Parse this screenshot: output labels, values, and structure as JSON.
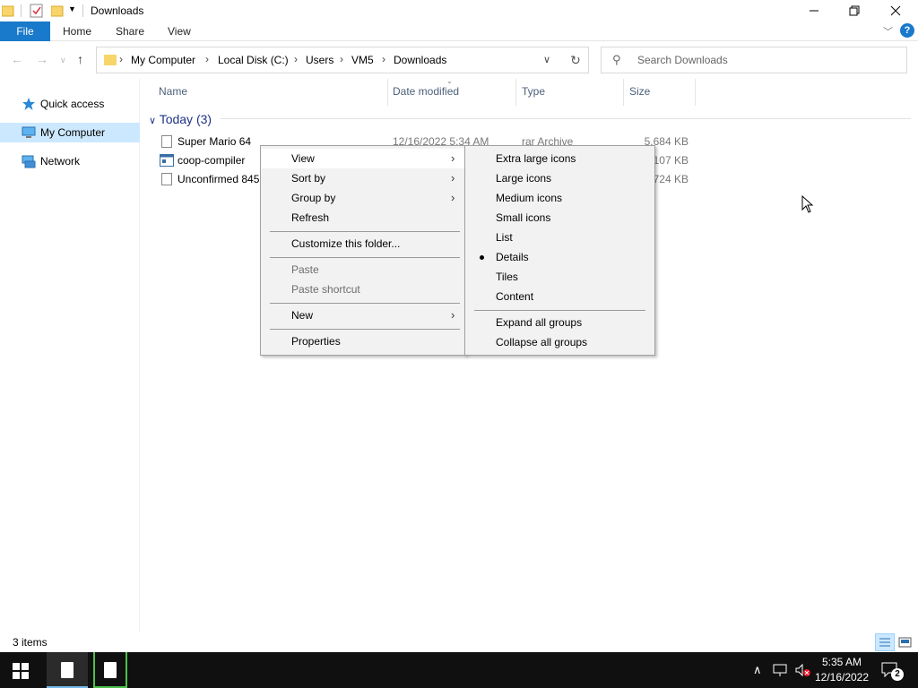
{
  "window": {
    "title": "Downloads",
    "controls": {
      "minimize": "minimize-icon",
      "maximize": "restore-icon",
      "close": "close-icon"
    }
  },
  "ribbon": {
    "file_tab": "File",
    "tabs": [
      "Home",
      "Share",
      "View"
    ]
  },
  "navigation": {
    "breadcrumbs": [
      "My Computer",
      "Local Disk (C:)",
      "Users",
      "VM5",
      "Downloads"
    ],
    "search_placeholder": "Search Downloads"
  },
  "sidebar": {
    "items": [
      {
        "label": "Quick access",
        "icon": "star-icon",
        "selected": false
      },
      {
        "label": "My Computer",
        "icon": "computer-icon",
        "selected": true
      },
      {
        "label": "Network",
        "icon": "network-icon",
        "selected": false
      }
    ]
  },
  "file_list": {
    "columns": [
      "Name",
      "Date modified",
      "Type",
      "Size"
    ],
    "group": {
      "label": "Today (3)"
    },
    "rows": [
      {
        "name": "Super Mario 64",
        "date": "12/16/2022 5:34 AM",
        "type": "rar Archive",
        "size": "5,684 KB",
        "icon": "file-icon"
      },
      {
        "name": "coop-compiler",
        "date": "",
        "type": "",
        "size": "107 KB",
        "icon": "app-icon"
      },
      {
        "name": "Unconfirmed 845",
        "date": "",
        "type": "",
        "size": ",724 KB",
        "icon": "file-icon"
      }
    ]
  },
  "status_bar": {
    "item_count": "3 items"
  },
  "context_menu": {
    "items": [
      {
        "label": "View",
        "submenu": true,
        "highlighted": true
      },
      {
        "label": "Sort by",
        "submenu": true
      },
      {
        "label": "Group by",
        "submenu": true
      },
      {
        "label": "Refresh"
      },
      {
        "label": "Customize this folder..."
      },
      {
        "label": "Paste",
        "disabled": true
      },
      {
        "label": "Paste shortcut",
        "disabled": true
      },
      {
        "label": "New",
        "submenu": true
      },
      {
        "label": "Properties"
      }
    ]
  },
  "view_submenu": {
    "items": [
      {
        "label": "Extra large icons"
      },
      {
        "label": "Large icons"
      },
      {
        "label": "Medium icons"
      },
      {
        "label": "Small icons"
      },
      {
        "label": "List"
      },
      {
        "label": "Details",
        "checked": true
      },
      {
        "label": "Tiles"
      },
      {
        "label": "Content"
      },
      {
        "label": "Expand all groups"
      },
      {
        "label": "Collapse all groups"
      }
    ]
  },
  "taskbar": {
    "time": "5:35 AM",
    "date": "12/16/2022",
    "notification_count": "2"
  },
  "colors": {
    "accent": "#1979ca",
    "selection": "#cce8ff",
    "menu_bg": "#f2f2f2",
    "group_header": "#1e3287"
  }
}
